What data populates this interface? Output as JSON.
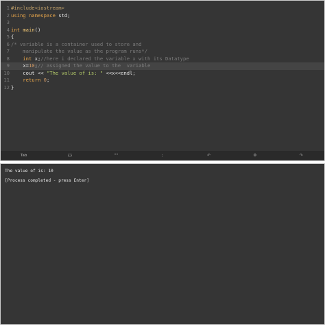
{
  "editor": {
    "lines": [
      {
        "num": "1",
        "tokens": [
          {
            "t": "#include<iostream>",
            "c": "pp"
          }
        ]
      },
      {
        "num": "2",
        "tokens": [
          {
            "t": "using ",
            "c": "kw"
          },
          {
            "t": "namespace ",
            "c": "kw"
          },
          {
            "t": "std;",
            "c": "plain"
          }
        ]
      },
      {
        "num": "3",
        "tokens": []
      },
      {
        "num": "4",
        "tokens": [
          {
            "t": "int ",
            "c": "type"
          },
          {
            "t": "main",
            "c": "fn"
          },
          {
            "t": "()",
            "c": "plain"
          }
        ]
      },
      {
        "num": "5",
        "tokens": [
          {
            "t": "{",
            "c": "plain"
          }
        ]
      },
      {
        "num": "6",
        "tokens": [
          {
            "t": "/* variable is a container used to store and",
            "c": "cm"
          }
        ]
      },
      {
        "num": "7",
        "tokens": [
          {
            "t": "    manipulate the value as the program runs*/",
            "c": "cm"
          }
        ]
      },
      {
        "num": "8",
        "tokens": [
          {
            "t": "    int ",
            "c": "type"
          },
          {
            "t": "x;",
            "c": "plain"
          },
          {
            "t": "//here i declared the variable x with its Datatype",
            "c": "cm"
          }
        ]
      },
      {
        "num": "9",
        "current": true,
        "tokens": [
          {
            "t": "    ",
            "c": "plain"
          },
          {
            "t": "x=",
            "c": "plain"
          },
          {
            "t": "10",
            "c": "num"
          },
          {
            "t": ";",
            "c": "plain"
          },
          {
            "t": "// assigned the value to the  variable",
            "c": "cm"
          }
        ]
      },
      {
        "num": "10",
        "tokens": [
          {
            "t": "    cout ",
            "c": "plain"
          },
          {
            "t": "<< ",
            "c": "op"
          },
          {
            "t": "\"The value of is: \"",
            "c": "str"
          },
          {
            "t": " <<x<<endl;",
            "c": "plain"
          }
        ]
      },
      {
        "num": "11",
        "tokens": [
          {
            "t": "    return ",
            "c": "kw"
          },
          {
            "t": "0",
            "c": "num"
          },
          {
            "t": ";",
            "c": "plain"
          }
        ]
      },
      {
        "num": "12",
        "tokens": [
          {
            "t": "}",
            "c": "plain"
          }
        ]
      }
    ]
  },
  "keys": [
    {
      "label": "Tab",
      "icon": "tab-key"
    },
    {
      "label": "{}",
      "icon": "braces-key"
    },
    {
      "label": "\"\"",
      "icon": "quotes-key"
    },
    {
      "label": ";",
      "icon": "semicolon-key"
    },
    {
      "label": "↶",
      "icon": "undo-icon"
    },
    {
      "label": "⚙",
      "icon": "settings-icon"
    },
    {
      "label": "↷",
      "icon": "redo-icon"
    }
  ],
  "terminal": {
    "output_line": "The value of is: 10",
    "status_line": "[Process completed - press Enter]"
  }
}
